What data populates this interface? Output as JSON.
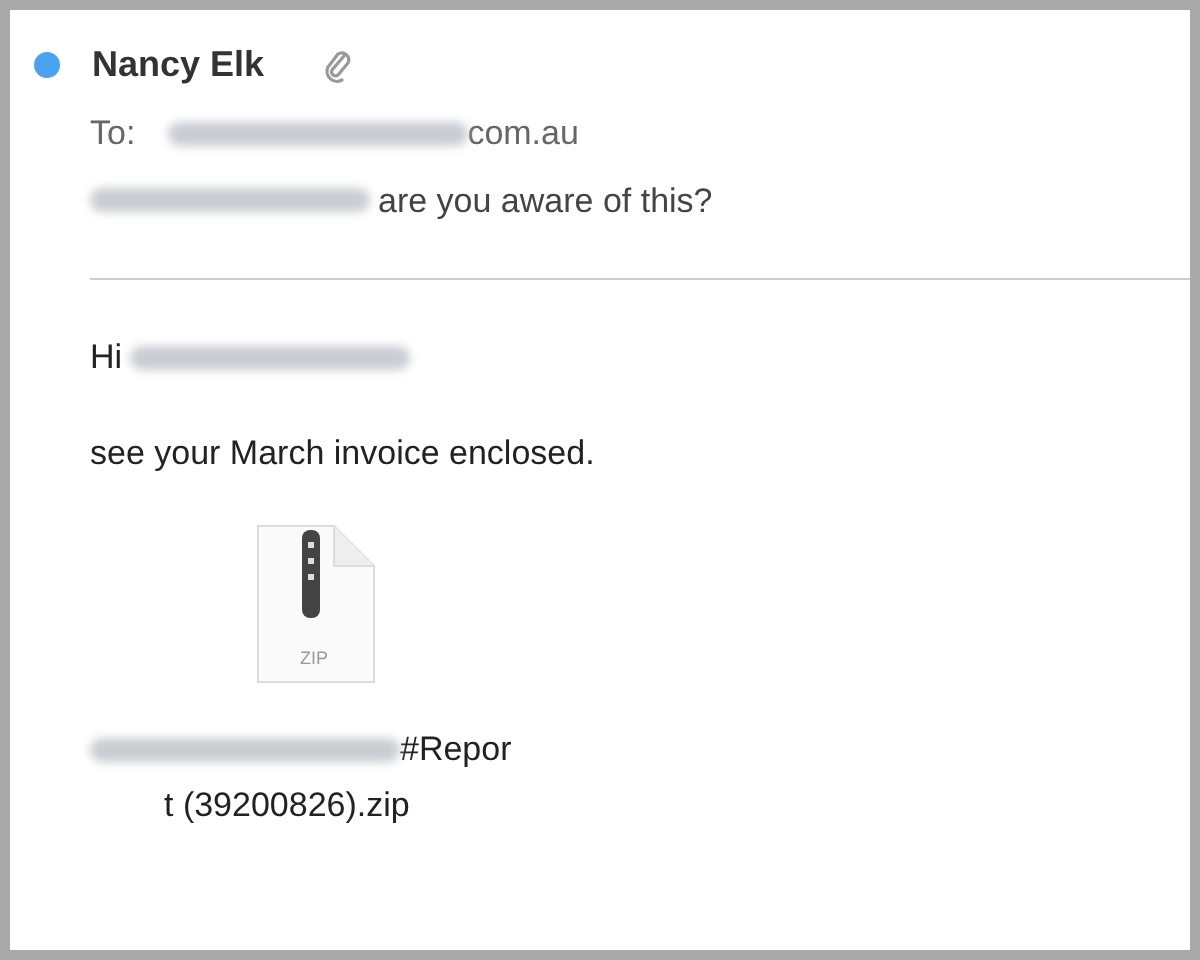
{
  "message": {
    "unread": true,
    "sender": "Nancy Elk",
    "has_attachment": true,
    "to": {
      "label": "To:",
      "segments": [
        {
          "kind": "redacted"
        },
        {
          "kind": "text",
          "text": "com.au"
        }
      ]
    },
    "subject": {
      "segments": [
        {
          "kind": "redacted"
        },
        {
          "kind": "text",
          "text": "are you aware of this?"
        }
      ]
    },
    "body": [
      {
        "segments": [
          {
            "kind": "text",
            "text": "Hi"
          },
          {
            "kind": "redacted"
          }
        ]
      },
      {
        "segments": [
          {
            "kind": "text",
            "text": "see your March invoice enclosed."
          }
        ]
      }
    ],
    "attachment": {
      "file_type": "ZIP",
      "name_line_1": [
        {
          "kind": "redacted"
        },
        {
          "kind": "text",
          "text": "#Repor"
        }
      ],
      "name_line_2": "t (39200826).zip"
    }
  }
}
